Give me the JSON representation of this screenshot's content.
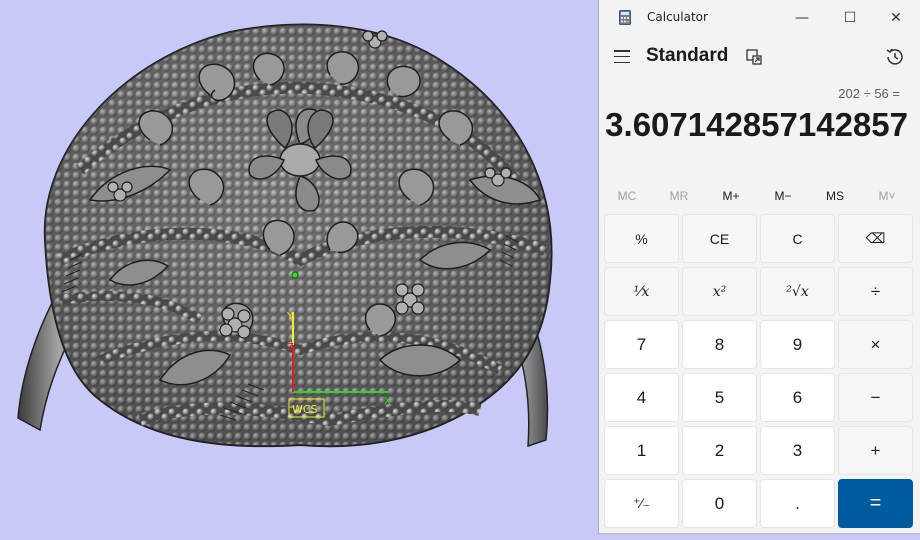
{
  "calculator": {
    "window_title": "Calculator",
    "mode": "Standard",
    "expression": "202 ÷ 56 =",
    "result": "3.607142857142857",
    "window_controls": {
      "minimize": "—",
      "maximize": "☐",
      "close": "✕"
    },
    "memory": [
      "MC",
      "MR",
      "M+",
      "M−",
      "MS",
      "M˅"
    ],
    "keys": [
      [
        "%",
        "CE",
        "C",
        "⌫"
      ],
      [
        "¹⁄x",
        "x²",
        "²√x",
        "÷"
      ],
      [
        "7",
        "8",
        "9",
        "×"
      ],
      [
        "4",
        "5",
        "6",
        "−"
      ],
      [
        "1",
        "2",
        "3",
        "+"
      ],
      [
        "⁺⁄₋",
        "0",
        ".",
        "="
      ]
    ],
    "accent_color": "#005a9e"
  },
  "viewport": {
    "background_color": "#c9c9f9",
    "wcs_label": "WCS",
    "axis_labels": {
      "x": "X",
      "y": "Y",
      "z": "Z"
    }
  }
}
